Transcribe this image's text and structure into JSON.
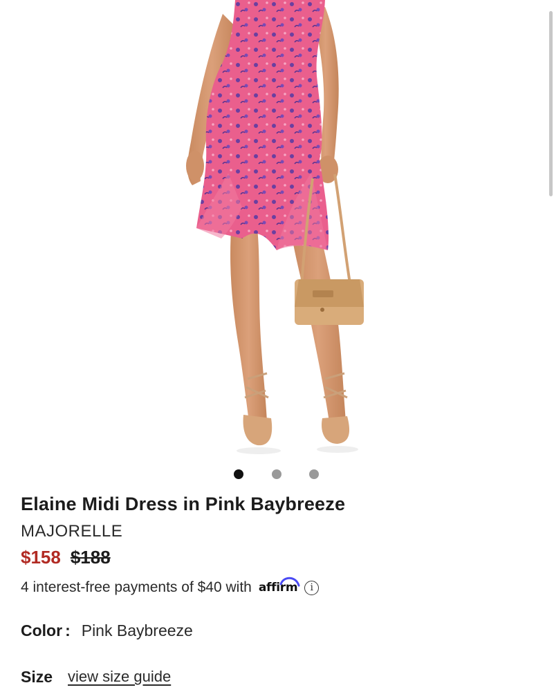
{
  "product": {
    "title": "Elaine Midi Dress in Pink Baybreeze",
    "brand": "MAJORELLE",
    "price_sale": "$158",
    "price_original": "$188",
    "installment_text": "4 interest-free payments of $40 with",
    "installment_provider": "affirm",
    "color_label": "Color",
    "color_colon": ":",
    "color_value": "Pink Baybreeze",
    "size_label": "Size",
    "size_guide_link": "view size guide"
  },
  "carousel": {
    "count": 3,
    "active_index": 0
  },
  "icons": {
    "info": "info-icon",
    "affirm_logo": "affirm-logo"
  },
  "colors": {
    "sale_price": "#b12a23",
    "dress": "#e8628e",
    "dress_print": "#6b3fa0",
    "bag": "#d9ac7a",
    "skin": "#d79a6f"
  }
}
